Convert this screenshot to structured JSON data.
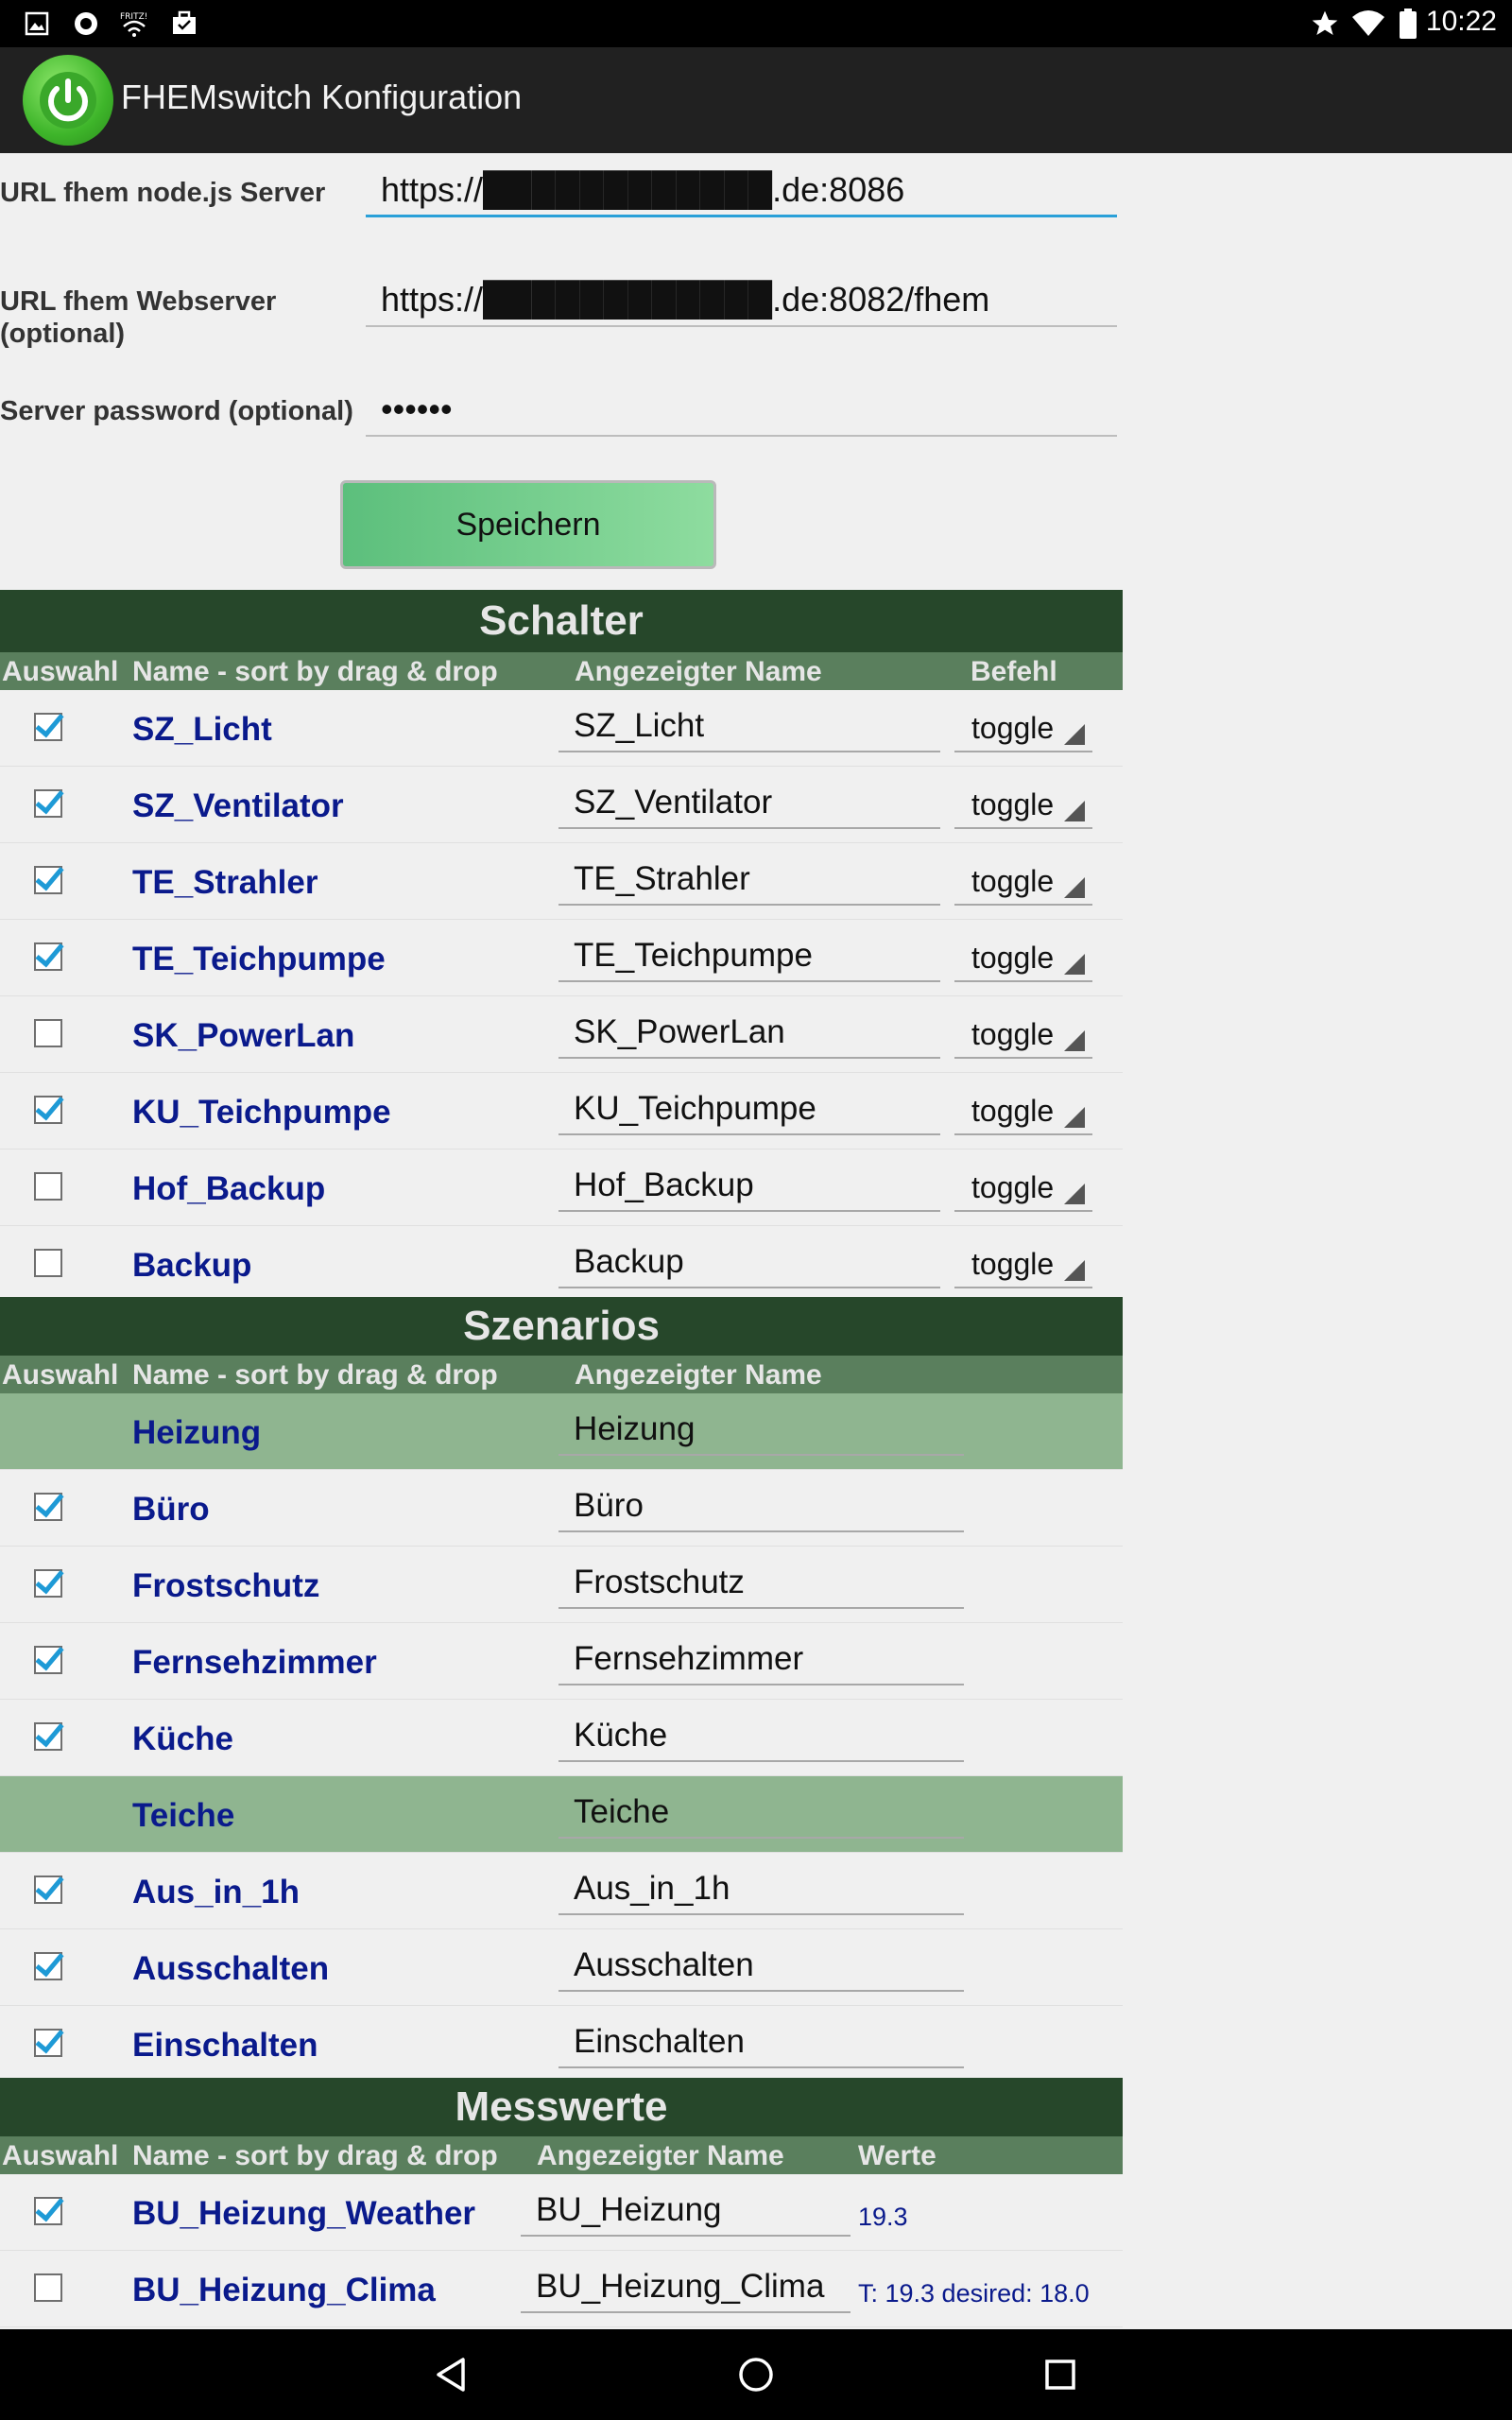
{
  "status_bar": {
    "time": "10:22",
    "left_icons": [
      "image-icon",
      "app-icon",
      "fritz-icon",
      "briefcase-icon"
    ],
    "right_icons": [
      "star-icon",
      "wifi-icon",
      "battery-icon"
    ]
  },
  "app_bar": {
    "title": "FHEMswitch Konfiguration",
    "logo": "power-icon"
  },
  "form": {
    "node_server_label": "URL fhem node.js Server",
    "node_server_value": "https://████████████.de:8086",
    "webserver_label": "URL fhem Webserver (optional)",
    "webserver_value": "https://████████████.de:8082/fhem",
    "password_label": "Server password (optional)",
    "password_value": "••••••",
    "save_label": "Speichern"
  },
  "schalter": {
    "title": "Schalter",
    "columns": [
      "Auswahl",
      "Name - sort by drag & drop",
      "Angezeigter Name",
      "Befehl"
    ],
    "rows": [
      {
        "checked": true,
        "name": "SZ_Licht",
        "display": "SZ_Licht",
        "command": "toggle"
      },
      {
        "checked": true,
        "name": "SZ_Ventilator",
        "display": "SZ_Ventilator",
        "command": "toggle"
      },
      {
        "checked": true,
        "name": "TE_Strahler",
        "display": "TE_Strahler",
        "command": "toggle"
      },
      {
        "checked": true,
        "name": "TE_Teichpumpe",
        "display": "TE_Teichpumpe",
        "command": "toggle"
      },
      {
        "checked": false,
        "name": "SK_PowerLan",
        "display": "SK_PowerLan",
        "command": "toggle"
      },
      {
        "checked": true,
        "name": "KU_Teichpumpe",
        "display": "KU_Teichpumpe",
        "command": "toggle"
      },
      {
        "checked": false,
        "name": "Hof_Backup",
        "display": "Hof_Backup",
        "command": "toggle"
      },
      {
        "checked": false,
        "name": "Backup",
        "display": "Backup",
        "command": "toggle"
      }
    ]
  },
  "szenarios": {
    "title": "Szenarios",
    "columns": [
      "Auswahl",
      "Name - sort by drag & drop",
      "Angezeigter Name"
    ],
    "rows": [
      {
        "group": true,
        "name": "Heizung",
        "display": "Heizung"
      },
      {
        "checked": true,
        "name": "Büro",
        "display": "Büro"
      },
      {
        "checked": true,
        "name": "Frostschutz",
        "display": "Frostschutz"
      },
      {
        "checked": true,
        "name": "Fernsehzimmer",
        "display": "Fernsehzimmer"
      },
      {
        "checked": true,
        "name": "Küche",
        "display": "Küche"
      },
      {
        "group": true,
        "name": "Teiche",
        "display": "Teiche"
      },
      {
        "checked": true,
        "name": "Aus_in_1h",
        "display": "Aus_in_1h"
      },
      {
        "checked": true,
        "name": "Ausschalten",
        "display": "Ausschalten"
      },
      {
        "checked": true,
        "name": "Einschalten",
        "display": "Einschalten"
      }
    ]
  },
  "messwerte": {
    "title": "Messwerte",
    "columns": [
      "Auswahl",
      "Name - sort by drag & drop",
      "Angezeigter Name",
      "Werte"
    ],
    "rows": [
      {
        "checked": true,
        "name": "BU_Heizung_Weather",
        "display": "BU_Heizung",
        "value": "19.3"
      },
      {
        "checked": false,
        "name": "BU_Heizung_Clima",
        "display": "BU_Heizung_Clima",
        "value": "T: 19.3 desired: 18.0"
      }
    ]
  },
  "nav_bar": {
    "buttons": [
      "back-icon",
      "home-icon",
      "recents-icon"
    ]
  },
  "colors": {
    "section_header": "#26472a",
    "column_header": "#5a7f5d",
    "group_row": "#8fb590",
    "name_text": "#0a1a8c",
    "checkbox": "#1e9ad6",
    "save_button": "#5cbf7c"
  }
}
